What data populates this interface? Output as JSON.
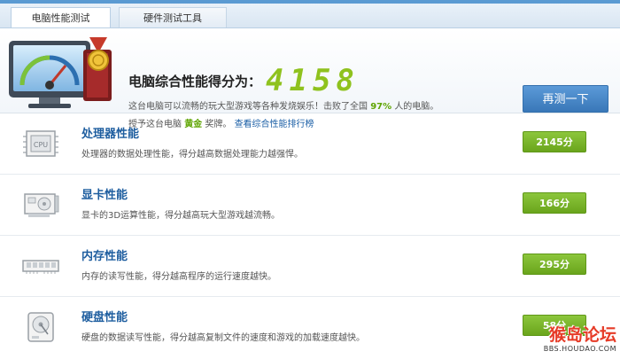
{
  "tabs": [
    {
      "label": "电脑性能测试",
      "active": true
    },
    {
      "label": "硬件测试工具",
      "active": false
    }
  ],
  "summary": {
    "title": "电脑综合性能得分为：",
    "score": "4158",
    "line1_before": "这台电脑可以流畅的玩大型游戏等各种发烧娱乐！击败了全国",
    "line1_percent": "97%",
    "line1_after": "人的电脑。",
    "line2_before": "授予这台电脑",
    "line2_medal": "黄金",
    "line2_after": "奖牌。",
    "line2_link": "查看综合性能排行榜",
    "retest_label": "再测一下",
    "accent_color": "#8fc21e"
  },
  "items": [
    {
      "icon": "cpu-icon",
      "title": "处理器性能",
      "desc": "处理器的数据处理性能，得分越高数据处理能力越强悍。",
      "score": "2145分"
    },
    {
      "icon": "graphics-card-icon",
      "title": "显卡性能",
      "desc": "显卡的3D运算性能，得分越高玩大型游戏越流畅。",
      "score": "166分"
    },
    {
      "icon": "memory-icon",
      "title": "内存性能",
      "desc": "内存的读写性能，得分越高程序的运行速度越快。",
      "score": "295分"
    },
    {
      "icon": "hard-disk-icon",
      "title": "硬盘性能",
      "desc": "硬盘的数据读写性能，得分越高复制文件的速度和游戏的加载速度越快。",
      "score": "58分"
    }
  ],
  "watermark": {
    "main": "猴岛论坛",
    "sub": "BBS.HOUDAO.COM"
  }
}
